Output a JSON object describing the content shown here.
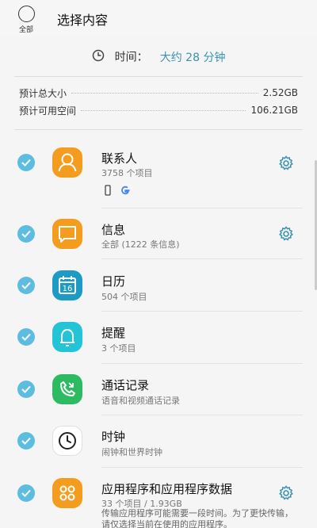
{
  "header": {
    "all_label": "全部",
    "title": "选择内容"
  },
  "time": {
    "label": "时间：",
    "value": "大约 28 分钟"
  },
  "sizes": [
    {
      "label": "预计总大小",
      "value": "2.52GB"
    },
    {
      "label": "预计可用空间",
      "value": "106.21GB"
    }
  ],
  "items": [
    {
      "title": "联系人",
      "subtitle": "3758 个项目",
      "icon": "contacts-icon",
      "color": "#f39c1e",
      "settings": true,
      "checked": true
    },
    {
      "title": "信息",
      "subtitle": "全部 (1222 条信息)",
      "icon": "messages-icon",
      "color": "#f39c1e",
      "settings": true,
      "checked": true
    },
    {
      "title": "日历",
      "subtitle": "504 个项目",
      "icon": "calendar-icon",
      "color": "#1e9bc4",
      "settings": false,
      "checked": true
    },
    {
      "title": "提醒",
      "subtitle": "3 个项目",
      "icon": "reminder-icon",
      "color": "#22c4d6",
      "settings": false,
      "checked": true
    },
    {
      "title": "通话记录",
      "subtitle": "语音和视频通话记录",
      "icon": "phone-log-icon",
      "color": "#2dbb62",
      "settings": false,
      "checked": true
    },
    {
      "title": "时钟",
      "subtitle": "闹钟和世界时钟",
      "icon": "clock-app-icon",
      "color": "#ffffff",
      "settings": false,
      "checked": true
    },
    {
      "title": "应用程序和应用程序数据",
      "subtitle": "33 个项目 / 1.93GB",
      "icon": "apps-icon",
      "color": "#f39c1e",
      "settings": true,
      "checked": true
    }
  ],
  "apps_description": "传输应用程序可能需要一段时间。为了更快传输，请仅选择当前在使用的应用程序。",
  "calendar_day": "16",
  "colors": {
    "accent": "#3a93b3",
    "check": "#5dbde0"
  }
}
